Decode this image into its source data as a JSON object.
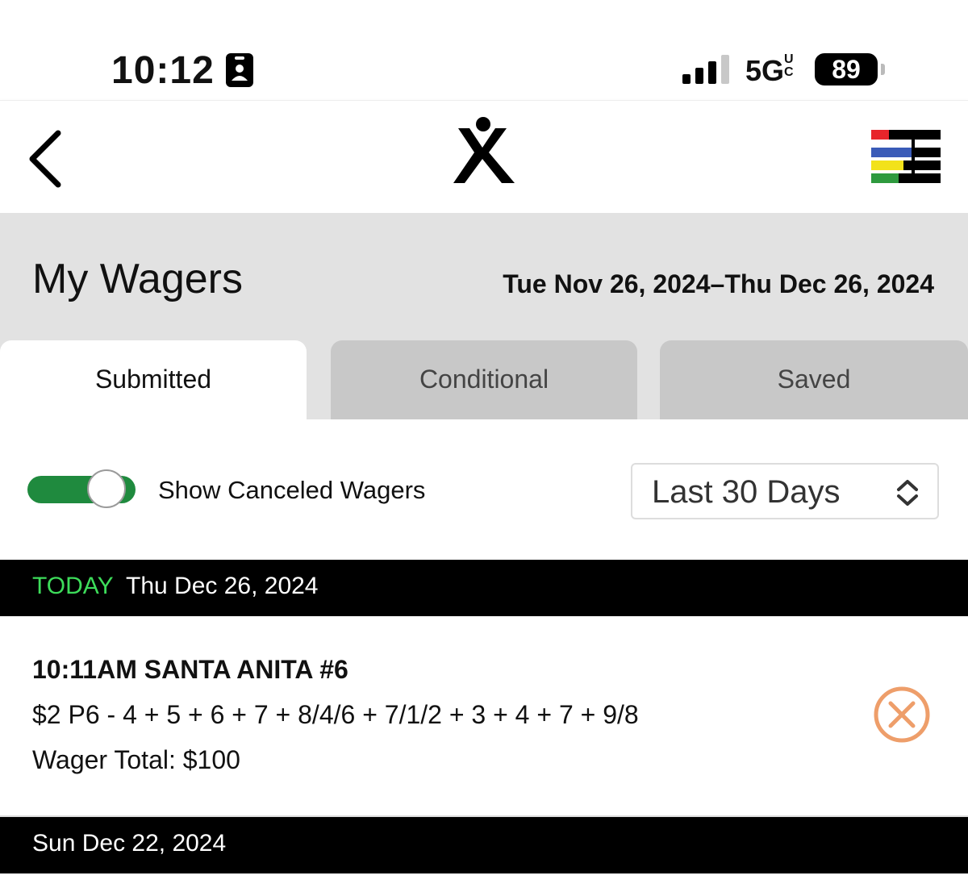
{
  "status_bar": {
    "time": "10:12",
    "network": "5G",
    "network_suffix": "UC",
    "battery": "89",
    "icons": [
      "id-card-icon",
      "signal-bars-icon",
      "battery-icon"
    ]
  },
  "nav": {
    "back_icon": "chevron-left-icon",
    "logo_icon": "xpressbet-logo-icon",
    "menu_icon": "colored-menu-icon",
    "menu_colors": [
      "#e8252b",
      "#3a5bb8",
      "#f2e21a",
      "#2e9a3e"
    ]
  },
  "header": {
    "title": "My Wagers",
    "date_range": "Tue Nov 26, 2024–Thu Dec 26, 2024",
    "background": "#e2e2e2"
  },
  "tabs": [
    {
      "label": "Submitted",
      "active": true
    },
    {
      "label": "Conditional",
      "active": false
    },
    {
      "label": "Saved",
      "active": false
    }
  ],
  "filters": {
    "show_canceled_label": "Show Canceled Wagers",
    "show_canceled_on": true,
    "range_value": "Last 30 Days",
    "toggle_color": "#1f8a3e"
  },
  "days": [
    {
      "today_label": "TODAY",
      "date": "Thu Dec 26, 2024",
      "wagers": [
        {
          "title": "10:11AM SANTA ANITA #6",
          "detail": "$2 P6 - 4 + 5 + 6 + 7 + 8/4/6 + 7/1/2 + 3 + 4 + 7 + 9/8",
          "total": "Wager Total: $100",
          "cancel_icon": "cancel-circle-x-icon",
          "cancel_color": "#ee9e6a"
        }
      ]
    },
    {
      "date": "Sun Dec 22, 2024"
    }
  ],
  "colors": {
    "today_green": "#3ddc5a",
    "day_bar_bg": "#000000"
  }
}
